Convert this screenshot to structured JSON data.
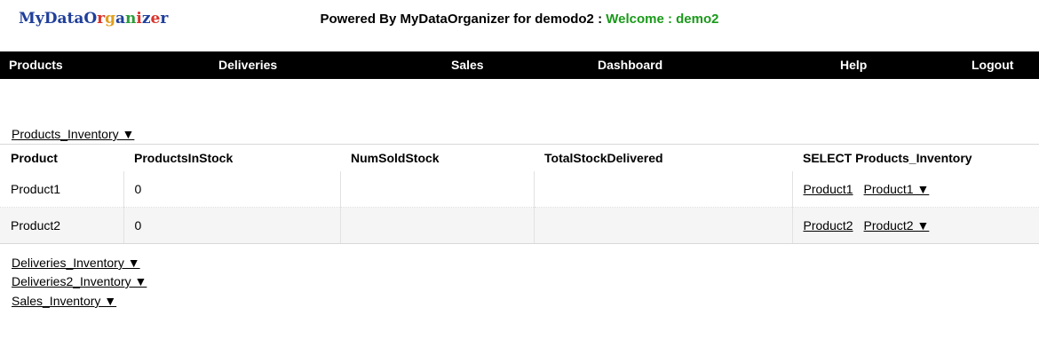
{
  "logo": {
    "letters": [
      {
        "ch": "M",
        "color": "#1f3f9a"
      },
      {
        "ch": "y",
        "color": "#1f3f9a"
      },
      {
        "ch": "D",
        "color": "#1f3f9a"
      },
      {
        "ch": "a",
        "color": "#1f3f9a"
      },
      {
        "ch": "t",
        "color": "#1f3f9a"
      },
      {
        "ch": "a",
        "color": "#1f3f9a"
      },
      {
        "ch": "O",
        "color": "#1f3f9a"
      },
      {
        "ch": "r",
        "color": "#d9342b"
      },
      {
        "ch": "g",
        "color": "#e0a020"
      },
      {
        "ch": "a",
        "color": "#1f3f9a"
      },
      {
        "ch": "n",
        "color": "#2a9d3a"
      },
      {
        "ch": "i",
        "color": "#d9342b"
      },
      {
        "ch": "z",
        "color": "#1f3f9a"
      },
      {
        "ch": "e",
        "color": "#d9342b"
      },
      {
        "ch": "r",
        "color": "#1f3f9a"
      }
    ]
  },
  "header": {
    "powered_by": "Powered By MyDataOrganizer for demodo2 : ",
    "welcome": "Welcome : demo2"
  },
  "nav": {
    "products": "Products",
    "deliveries": "Deliveries",
    "sales": "Sales",
    "dashboard": "Dashboard",
    "help": "Help",
    "logout": "Logout"
  },
  "sections": {
    "products_inventory": "Products_Inventory ▼",
    "deliveries_inventory": "Deliveries_Inventory ▼",
    "deliveries2_inventory": "Deliveries2_Inventory ▼",
    "sales_inventory": "Sales_Inventory ▼"
  },
  "table": {
    "headers": [
      "Product",
      "ProductsInStock",
      "NumSoldStock",
      "TotalStockDelivered",
      "SELECT Products_Inventory"
    ],
    "rows": [
      {
        "product": "Product1",
        "in_stock": "0",
        "num_sold": "",
        "total_delivered": "",
        "select_link": "Product1",
        "select_dropdown": "Product1 ▼"
      },
      {
        "product": "Product2",
        "in_stock": "0",
        "num_sold": "",
        "total_delivered": "",
        "select_link": "Product2",
        "select_dropdown": "Product2 ▼"
      }
    ]
  }
}
